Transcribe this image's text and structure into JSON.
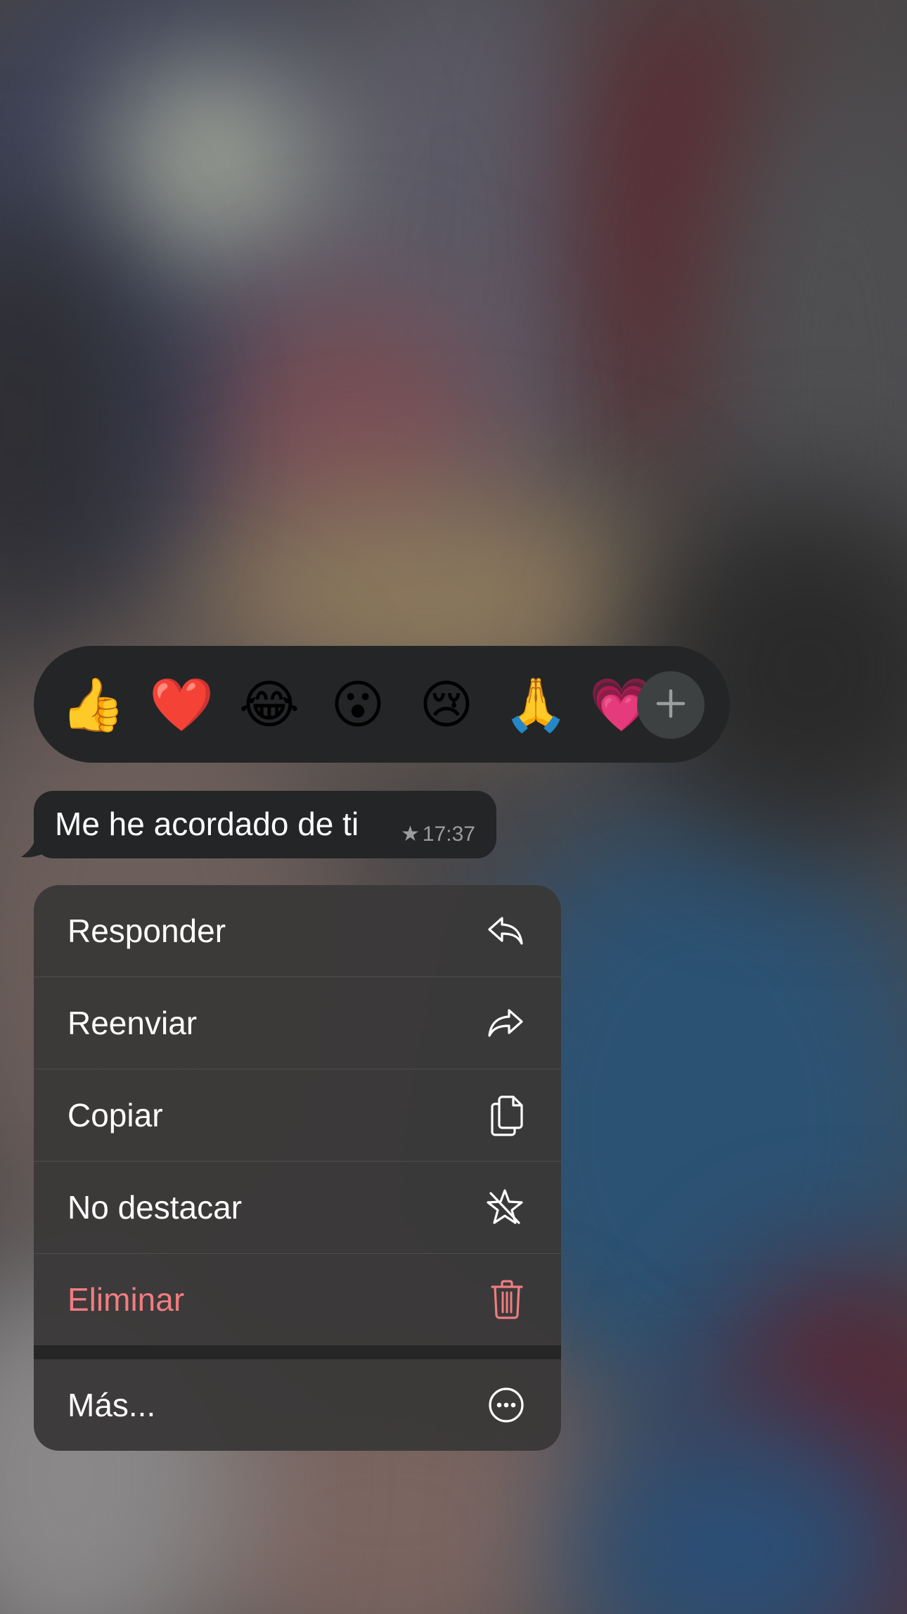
{
  "reactions": {
    "emojis": [
      {
        "name": "thumbs-up",
        "glyph": "👍"
      },
      {
        "name": "red-heart",
        "glyph": "❤️"
      },
      {
        "name": "tears-of-joy",
        "glyph": "😂"
      },
      {
        "name": "surprised-face",
        "glyph": "😮"
      },
      {
        "name": "crying-face",
        "glyph": "😢"
      },
      {
        "name": "folded-hands",
        "glyph": "🙏"
      },
      {
        "name": "heart-partial",
        "glyph": "💗"
      }
    ],
    "add_icon": "plus-icon"
  },
  "message": {
    "text": "Me he acordado de ti",
    "time": "17:37",
    "starred_icon": "star-icon"
  },
  "menu": {
    "items": [
      {
        "label": "Responder",
        "icon": "reply-icon"
      },
      {
        "label": "Reenviar",
        "icon": "forward-icon"
      },
      {
        "label": "Copiar",
        "icon": "copy-icon"
      },
      {
        "label": "No destacar",
        "icon": "unstar-icon"
      },
      {
        "label": "Eliminar",
        "icon": "trash-icon",
        "color": "#f07c80"
      },
      {
        "label": "Más...",
        "icon": "more-icon"
      }
    ]
  },
  "colors": {
    "menu_bg": "#3a3838",
    "bubble_bg": "#232526",
    "danger": "#f07c80"
  }
}
